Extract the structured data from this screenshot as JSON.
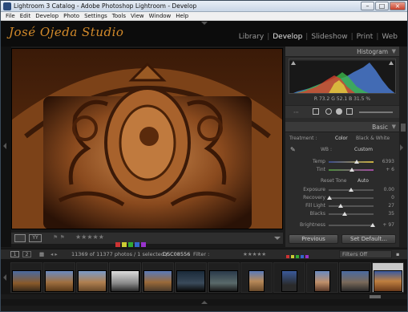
{
  "window": {
    "title": "Lightroom 3 Catalog - Adobe Photoshop Lightroom - Develop"
  },
  "menu": [
    "File",
    "Edit",
    "Develop",
    "Photo",
    "Settings",
    "Tools",
    "View",
    "Window",
    "Help"
  ],
  "identity_plate": "José Ojeda Studio",
  "modules": [
    "Library",
    "Develop",
    "Slideshow",
    "Print",
    "Web"
  ],
  "active_module": "Develop",
  "histogram": {
    "title": "Histogram",
    "readout": {
      "r": "73.2",
      "g": "52.1",
      "b": "31.5",
      "unit": "%"
    }
  },
  "basic": {
    "title": "Basic",
    "treatment_label": "Treatment :",
    "color": "Color",
    "bw": "Black & White",
    "wb_label": "WB :",
    "wb_value": "Custom",
    "temp": {
      "label": "Temp",
      "value": "6393",
      "pos": 0.62
    },
    "tint": {
      "label": "Tint",
      "value": "+ 6",
      "pos": 0.52
    },
    "tone_label": "Reset Tone",
    "auto": "Auto",
    "exposure": {
      "label": "Exposure",
      "value": "0.00",
      "pos": 0.5
    },
    "recovery": {
      "label": "Recovery",
      "value": "0",
      "pos": 0.02
    },
    "fill": {
      "label": "Fill Light",
      "value": "27",
      "pos": 0.27
    },
    "blacks": {
      "label": "Blacks",
      "value": "35",
      "pos": 0.35
    },
    "brightness": {
      "label": "Brightness",
      "value": "+ 97",
      "pos": 0.98
    }
  },
  "buttons": {
    "previous": "Previous",
    "reset": "Set Default..."
  },
  "filmstrip": {
    "page1": "1",
    "page2": "2",
    "count": "11369 of 11377 photos / 1 selected /",
    "filename": "DSC08556",
    "filter_label": "Filter :",
    "filters_off": "Filters Off"
  },
  "colors": {
    "accent": "#d38a2a",
    "panel": "#2b2b2b"
  }
}
